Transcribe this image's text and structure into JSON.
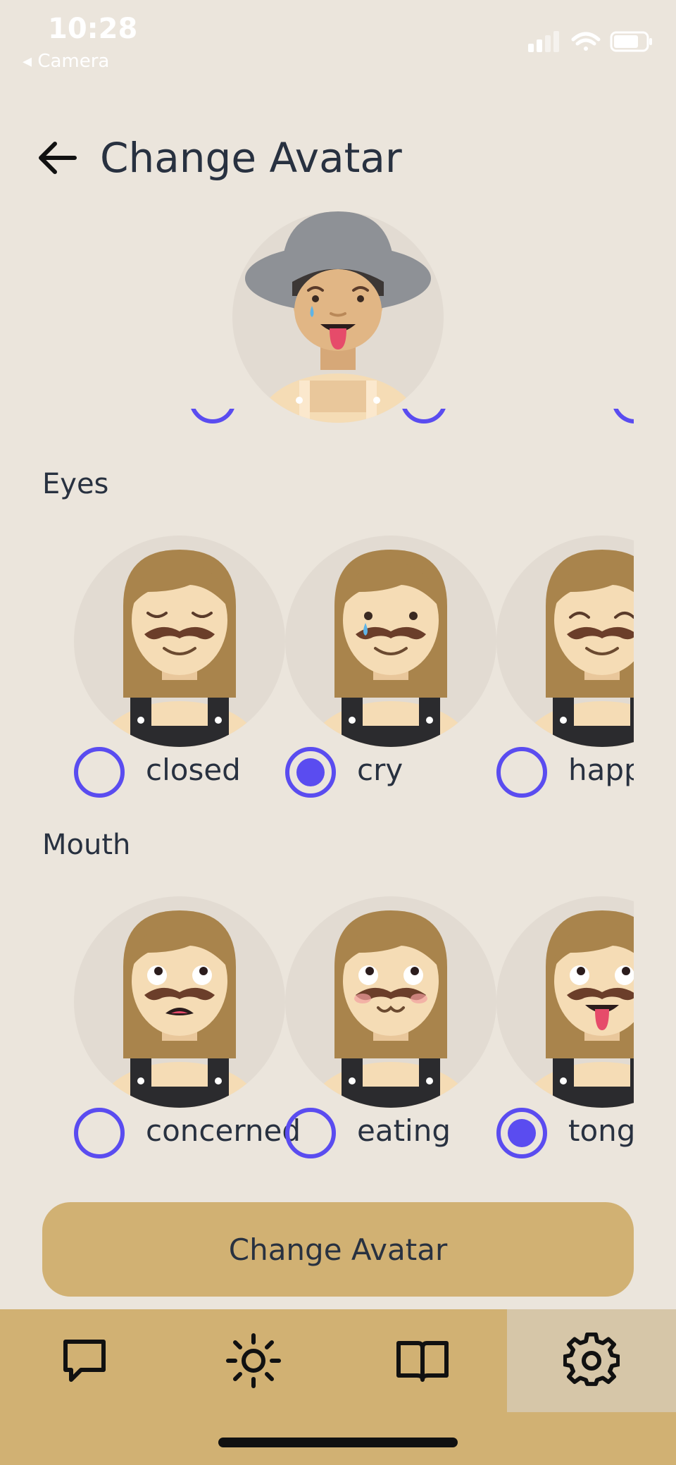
{
  "status": {
    "time": "10:28",
    "back_app": "◂ Camera"
  },
  "header": {
    "title": "Change Avatar"
  },
  "sections": {
    "eyes": {
      "label": "Eyes",
      "options": [
        {
          "label": "closed",
          "selected": false
        },
        {
          "label": "cry",
          "selected": true
        },
        {
          "label": "happ",
          "selected": false
        }
      ]
    },
    "mouth": {
      "label": "Mouth",
      "options": [
        {
          "label": "concerned",
          "selected": false
        },
        {
          "label": "eating",
          "selected": false
        },
        {
          "label": "tong",
          "selected": true
        }
      ]
    }
  },
  "actions": {
    "change_avatar": "Change Avatar"
  },
  "tabs": [
    {
      "icon": "chat-icon",
      "active": false
    },
    {
      "icon": "sun-icon",
      "active": false
    },
    {
      "icon": "book-icon",
      "active": false
    },
    {
      "icon": "gear-icon",
      "active": true
    }
  ],
  "colors": {
    "background": "#ebe5dc",
    "accent": "#5a4cf0",
    "brand": "#d1b173",
    "text": "#283140"
  }
}
